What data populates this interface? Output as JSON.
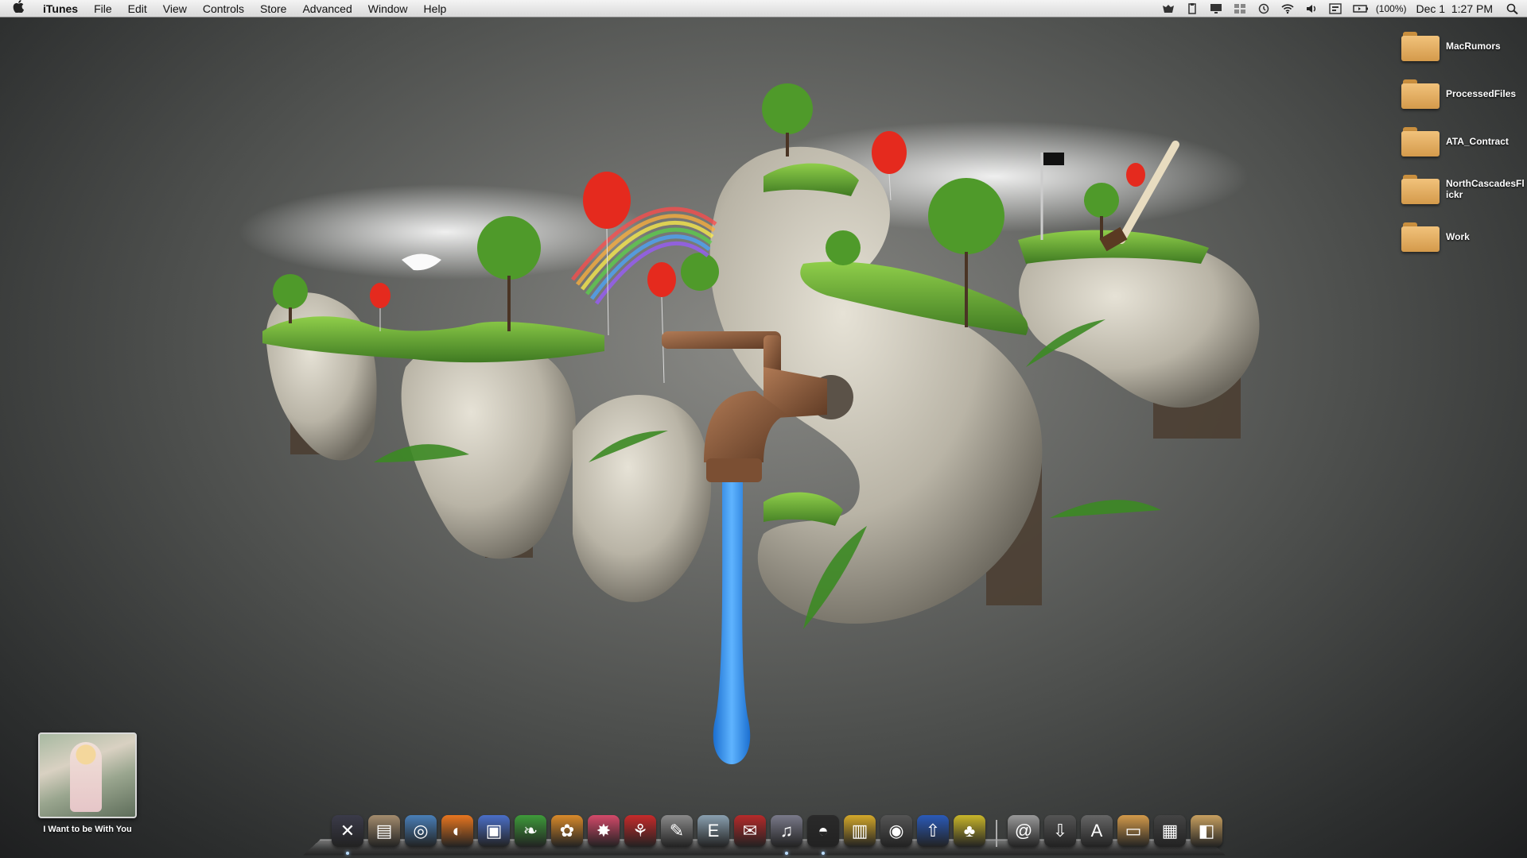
{
  "menubar": {
    "app_name": "iTunes",
    "menus": [
      "File",
      "Edit",
      "View",
      "Controls",
      "Store",
      "Advanced",
      "Window",
      "Help"
    ],
    "battery_text": "(100%)",
    "date": "Dec 1",
    "time": "1:27 PM",
    "status_icons": [
      "growl-icon",
      "clipboard-icon",
      "display-icon",
      "spaces-icon",
      "time-machine-icon",
      "wifi-icon",
      "volume-icon",
      "input-menu-icon",
      "battery-icon",
      "spotlight-icon"
    ]
  },
  "desktop": {
    "folders": [
      {
        "label": "MacRumors"
      },
      {
        "label": "ProcessedFiles"
      },
      {
        "label": "ATA_Contract"
      },
      {
        "label": "NorthCascadesFlickr"
      },
      {
        "label": "Work"
      }
    ]
  },
  "itunes_widget": {
    "song_title": "I Want to be With You"
  },
  "dock": {
    "icons": [
      {
        "name": "finder-x-icon",
        "color": "#3b3b4a",
        "glyph": "✕"
      },
      {
        "name": "notebook-icon",
        "color": "#a48c6e",
        "glyph": "▤"
      },
      {
        "name": "compass-icon",
        "color": "#4a7fb8",
        "glyph": "◎"
      },
      {
        "name": "firefox-icon",
        "color": "#e8761f",
        "glyph": "◐"
      },
      {
        "name": "iphoto-icon",
        "color": "#4b6fc8",
        "glyph": "▣"
      },
      {
        "name": "leaf-icon",
        "color": "#3e9b3a",
        "glyph": "❧"
      },
      {
        "name": "butterfly-icon",
        "color": "#d98a2a",
        "glyph": "✿"
      },
      {
        "name": "starburst-icon",
        "color": "#d44a6a",
        "glyph": "✸"
      },
      {
        "name": "acrobat-icon",
        "color": "#c62a2a",
        "glyph": "⚘"
      },
      {
        "name": "pen-icon",
        "color": "#8a8a8a",
        "glyph": "✎"
      },
      {
        "name": "text-editor-icon",
        "color": "#8aa0b0",
        "glyph": "E"
      },
      {
        "name": "mail-icon",
        "color": "#b52a2a",
        "glyph": "✉"
      },
      {
        "name": "itunes-icon",
        "color": "#7a7a8a",
        "glyph": "♫"
      },
      {
        "name": "camino-icon",
        "color": "#2a2a2a",
        "glyph": "◓"
      },
      {
        "name": "photo-booth-icon",
        "color": "#d4a82a",
        "glyph": "▥"
      },
      {
        "name": "camera-icon",
        "color": "#555",
        "glyph": "◉"
      },
      {
        "name": "flickr-upload-icon",
        "color": "#2a5ab8",
        "glyph": "⇧"
      },
      {
        "name": "frog-icon",
        "color": "#c9b62a",
        "glyph": "♣"
      },
      {
        "name": "separator",
        "color": "",
        "glyph": ""
      },
      {
        "name": "email-at-icon",
        "color": "#999",
        "glyph": "@"
      },
      {
        "name": "downloads-stack-icon",
        "color": "#555",
        "glyph": "⇩"
      },
      {
        "name": "applications-stack-icon",
        "color": "#666",
        "glyph": "A"
      },
      {
        "name": "documents-folder-icon",
        "color": "#d49a4b",
        "glyph": "▭"
      },
      {
        "name": "screen-icon",
        "color": "#444",
        "glyph": "▦"
      },
      {
        "name": "package-icon",
        "color": "#c8a060",
        "glyph": "◧"
      }
    ]
  }
}
